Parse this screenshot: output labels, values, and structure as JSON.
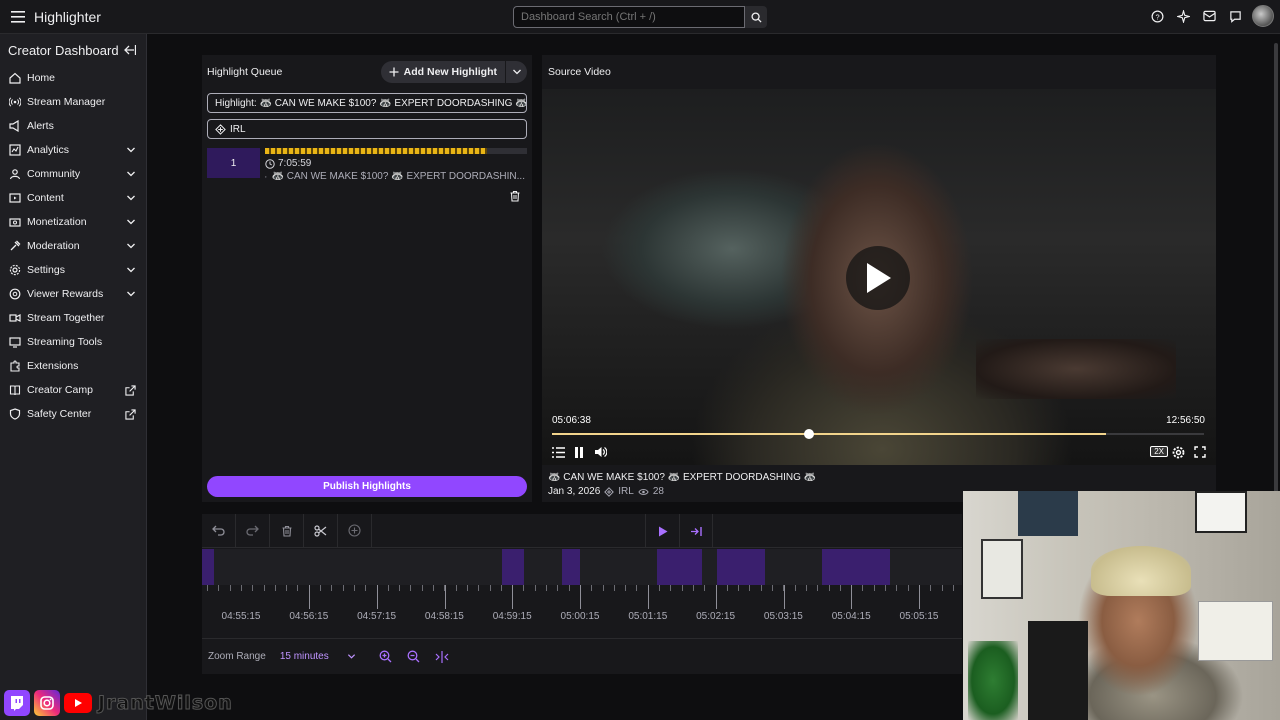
{
  "topbar": {
    "app_title": "Highlighter",
    "search_placeholder": "Dashboard Search (Ctrl + /)",
    "icons": [
      "help-icon",
      "sparkle-icon",
      "inbox-icon",
      "whispers-icon",
      "avatar"
    ]
  },
  "sidebar": {
    "title": "Creator Dashboard",
    "items": [
      {
        "label": "Home",
        "icon": "home-icon",
        "expandable": false
      },
      {
        "label": "Stream Manager",
        "icon": "broadcast-icon",
        "expandable": false
      },
      {
        "label": "Alerts",
        "icon": "alert-icon",
        "expandable": false
      },
      {
        "label": "Analytics",
        "icon": "analytics-icon",
        "expandable": true
      },
      {
        "label": "Community",
        "icon": "community-icon",
        "expandable": true
      },
      {
        "label": "Content",
        "icon": "content-icon",
        "expandable": true
      },
      {
        "label": "Monetization",
        "icon": "monetization-icon",
        "expandable": true
      },
      {
        "label": "Moderation",
        "icon": "moderation-icon",
        "expandable": true
      },
      {
        "label": "Settings",
        "icon": "settings-icon",
        "expandable": true
      },
      {
        "label": "Viewer Rewards",
        "icon": "rewards-icon",
        "expandable": true
      },
      {
        "label": "Stream Together",
        "icon": "stream-together-icon",
        "expandable": false
      },
      {
        "label": "Streaming Tools",
        "icon": "tools-icon",
        "expandable": false
      },
      {
        "label": "Extensions",
        "icon": "extensions-icon",
        "expandable": false
      },
      {
        "label": "Creator Camp",
        "icon": "camp-icon",
        "external": true
      },
      {
        "label": "Safety Center",
        "icon": "safety-icon",
        "external": true
      }
    ]
  },
  "queue": {
    "title": "Highlight Queue",
    "add_button": "Add New Highlight",
    "title_field": "Highlight: 🦝 CAN WE MAKE $100? 🦝 EXPERT DOORDASHING 🦝",
    "category_field": "IRL",
    "clip": {
      "number": "1",
      "duration": "7:05:59",
      "title": "🦝 CAN WE MAKE $100? 🦝 EXPERT DOORDASHIN..."
    },
    "publish_button": "Publish Highlights"
  },
  "source": {
    "title": "Source Video",
    "current_time": "05:06:38",
    "total_time": "12:56:50",
    "progress_fraction": 0.394,
    "buffered_fraction": 0.849,
    "speed": "2X",
    "video_title": "🦝 CAN WE MAKE $100? 🦝 EXPERT DOORDASHING 🦝",
    "date": "Jan 3, 2026",
    "category": "IRL",
    "views": "28"
  },
  "timeline": {
    "tick_labels": [
      "04:55:15",
      "04:56:15",
      "04:57:15",
      "04:58:15",
      "04:59:15",
      "05:00:15",
      "05:01:15",
      "05:02:15",
      "05:03:15",
      "05:04:15",
      "05:05:15"
    ],
    "zoom_label": "Zoom Range",
    "zoom_value": "15 minutes"
  },
  "colors": {
    "accent": "#9147ff",
    "accent_text": "#bf94ff",
    "highlight_bar": "#e9b516",
    "segment": "#3a1f6e"
  },
  "overlay": {
    "handle": "JrantWilson"
  }
}
